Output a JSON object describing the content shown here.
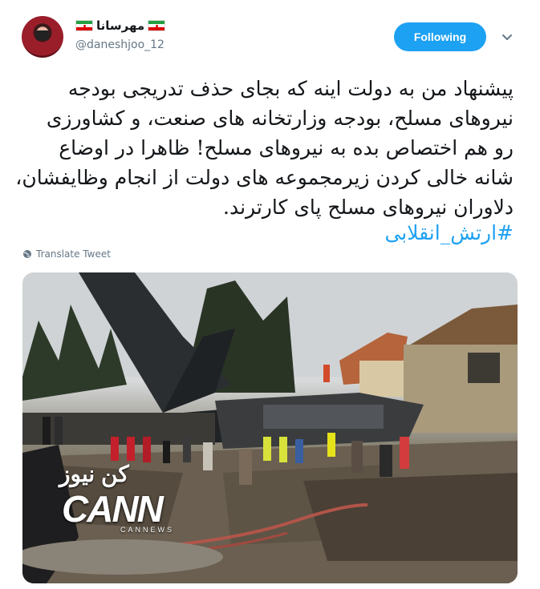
{
  "user": {
    "display_name": "مهرسانا",
    "handle": "@daneshjoo_12",
    "follow_label": "Following"
  },
  "tweet": {
    "lines": [
      "پیشنهاد من به دولت اینه که بجای حذف تدریجی بودجه",
      "نیروهای مسلح، بودجه وزارتخانه های صنعت، و کشاورزی",
      "رو هم اختصاص بده به نیروهای مسلح! ظاهرا در اوضاع",
      "شانه خالی کردن زیرمجموعه های دولت از انجام وظایفشان،",
      "دلاوران نیروهای مسلح پای کارترند."
    ],
    "hashtag": "#ارتش_انقلابی",
    "translate_label": "Translate Tweet"
  },
  "media": {
    "watermark_fa": "کن نیوز",
    "watermark_logo": "CANN",
    "watermark_sub": "CANNEWS"
  },
  "colors": {
    "accent": "#1da1f2",
    "muted": "#657786",
    "text": "#14171a"
  },
  "icons": {
    "caret": "chevron-down-icon",
    "translate": "globe-icon"
  }
}
